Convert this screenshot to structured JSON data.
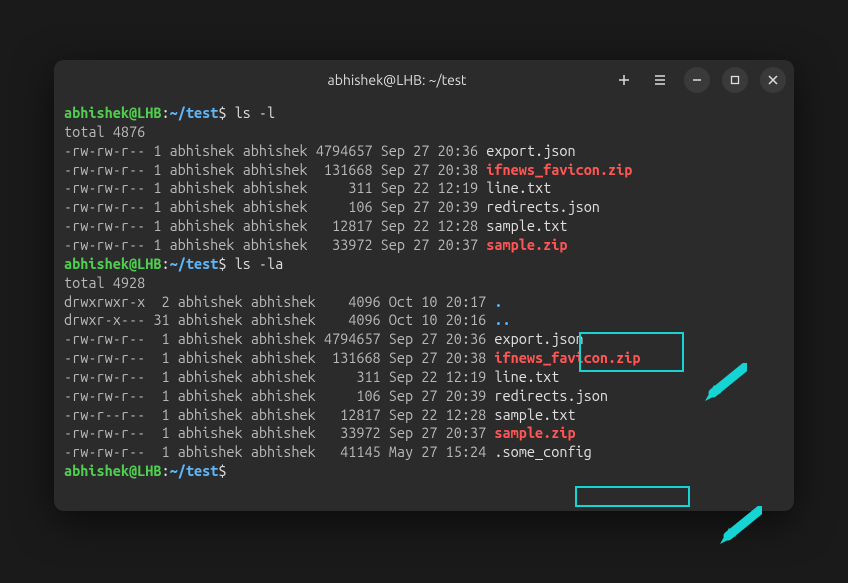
{
  "window": {
    "title": "abhishek@LHB: ~/test"
  },
  "prompt": {
    "user_host": "abhishek@LHB",
    "colon": ":",
    "tilde": "~",
    "path": "/test",
    "dollar": "$"
  },
  "commands": {
    "ls_l": "ls -l",
    "ls_la": "ls -la"
  },
  "output1": {
    "total": "total 4876",
    "rows": [
      {
        "perm": "-rw-rw-r--",
        "links": "1",
        "owner": "abhishek",
        "group": "abhishek",
        "size": "4794657",
        "date": "Sep 27 20:36",
        "name": "export.json",
        "style": "white"
      },
      {
        "perm": "-rw-rw-r--",
        "links": "1",
        "owner": "abhishek",
        "group": "abhishek",
        "size": " 131668",
        "date": "Sep 27 20:38",
        "name": "ifnews_favicon.zip",
        "style": "red"
      },
      {
        "perm": "-rw-rw-r--",
        "links": "1",
        "owner": "abhishek",
        "group": "abhishek",
        "size": "    311",
        "date": "Sep 22 12:19",
        "name": "line.txt",
        "style": "white"
      },
      {
        "perm": "-rw-rw-r--",
        "links": "1",
        "owner": "abhishek",
        "group": "abhishek",
        "size": "    106",
        "date": "Sep 27 20:39",
        "name": "redirects.json",
        "style": "white"
      },
      {
        "perm": "-rw-rw-r--",
        "links": "1",
        "owner": "abhishek",
        "group": "abhishek",
        "size": "  12817",
        "date": "Sep 22 12:28",
        "name": "sample.txt",
        "style": "white"
      },
      {
        "perm": "-rw-rw-r--",
        "links": "1",
        "owner": "abhishek",
        "group": "abhishek",
        "size": "  33972",
        "date": "Sep 27 20:37",
        "name": "sample.zip",
        "style": "red"
      }
    ]
  },
  "output2": {
    "total": "total 4928",
    "rows": [
      {
        "perm": "drwxrwxr-x",
        "links": " 2",
        "owner": "abhishek",
        "group": "abhishek",
        "size": "   4096",
        "date": "Oct 10 20:17",
        "name": ".",
        "style": "blue"
      },
      {
        "perm": "drwxr-x---",
        "links": "31",
        "owner": "abhishek",
        "group": "abhishek",
        "size": "   4096",
        "date": "Oct 10 20:16",
        "name": "..",
        "style": "blue"
      },
      {
        "perm": "-rw-rw-r--",
        "links": " 1",
        "owner": "abhishek",
        "group": "abhishek",
        "size": "4794657",
        "date": "Sep 27 20:36",
        "name": "export.json",
        "style": "white"
      },
      {
        "perm": "-rw-rw-r--",
        "links": " 1",
        "owner": "abhishek",
        "group": "abhishek",
        "size": " 131668",
        "date": "Sep 27 20:38",
        "name": "ifnews_favicon.zip",
        "style": "red"
      },
      {
        "perm": "-rw-rw-r--",
        "links": " 1",
        "owner": "abhishek",
        "group": "abhishek",
        "size": "    311",
        "date": "Sep 22 12:19",
        "name": "line.txt",
        "style": "white"
      },
      {
        "perm": "-rw-rw-r--",
        "links": " 1",
        "owner": "abhishek",
        "group": "abhishek",
        "size": "    106",
        "date": "Sep 27 20:39",
        "name": "redirects.json",
        "style": "white"
      },
      {
        "perm": "-rw-r--r--",
        "links": " 1",
        "owner": "abhishek",
        "group": "abhishek",
        "size": "  12817",
        "date": "Sep 22 12:28",
        "name": "sample.txt",
        "style": "white"
      },
      {
        "perm": "-rw-rw-r--",
        "links": " 1",
        "owner": "abhishek",
        "group": "abhishek",
        "size": "  33972",
        "date": "Sep 27 20:37",
        "name": "sample.zip",
        "style": "red"
      },
      {
        "perm": "-rw-rw-r--",
        "links": " 1",
        "owner": "abhishek",
        "group": "abhishek",
        "size": "  41145",
        "date": "May 27 15:24",
        "name": ".some_config",
        "style": "white"
      }
    ]
  }
}
